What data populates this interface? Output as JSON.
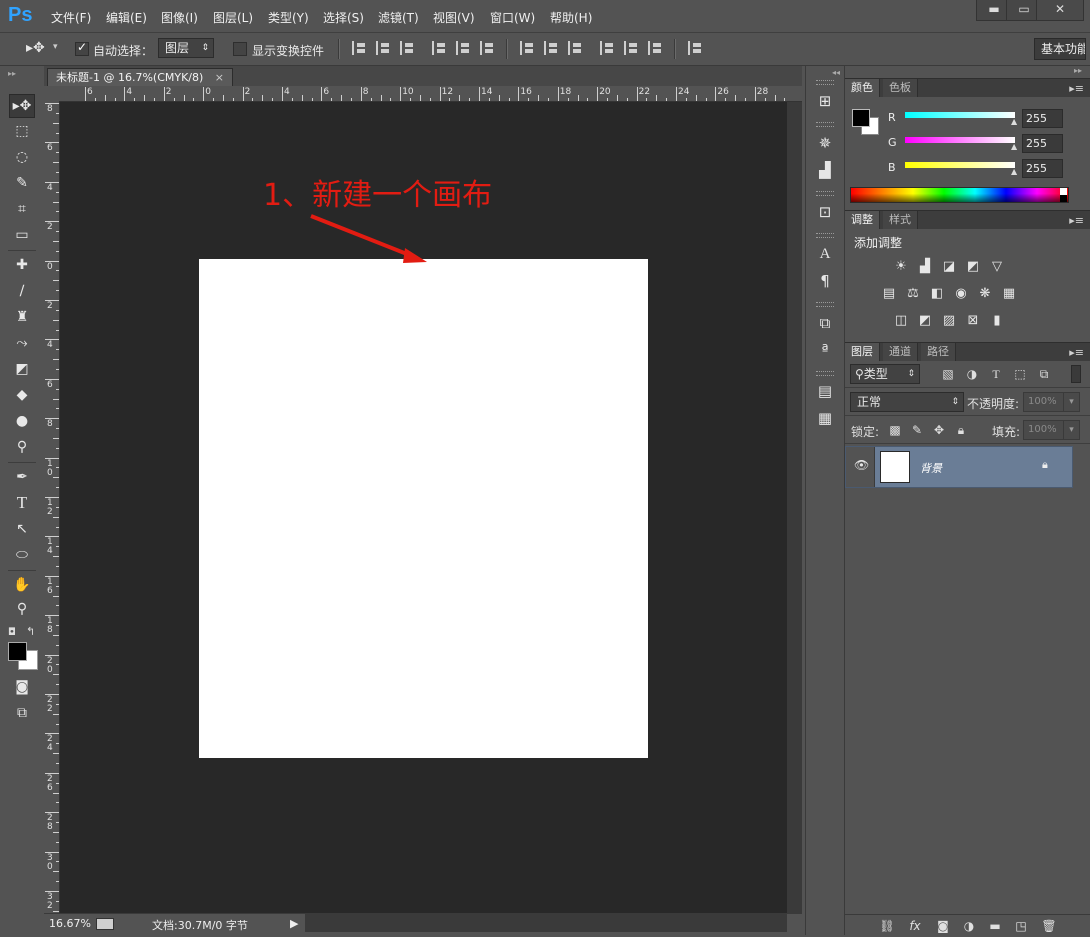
{
  "app": {
    "logo": "Ps"
  },
  "menu": {
    "items": [
      "文件(F)",
      "编辑(E)",
      "图像(I)",
      "图层(L)",
      "类型(Y)",
      "选择(S)",
      "滤镜(T)",
      "视图(V)",
      "窗口(W)",
      "帮助(H)"
    ]
  },
  "window_controls": {
    "minimize": "▬",
    "maximize": "▭",
    "close": "✕"
  },
  "options": {
    "auto_select_label": "自动选择：",
    "auto_select_checked": true,
    "target_value": "图层",
    "show_transform_label": "显示变换控件",
    "show_transform_checked": false,
    "workspace": "基本功能"
  },
  "document": {
    "tab_title": "未标题-1 @ 16.7%(CMYK/8)",
    "tab_close": "×",
    "h_ruler_labels": [
      "6",
      "4",
      "2",
      "0",
      "2",
      "4",
      "6",
      "8",
      "10",
      "12",
      "14",
      "16",
      "18",
      "20",
      "22",
      "24",
      "26",
      "28"
    ],
    "v_ruler_labels": [
      "8",
      "6",
      "4",
      "2",
      "0",
      "2",
      "4",
      "6",
      "8",
      "10",
      "12",
      "14",
      "16",
      "18",
      "20",
      "22",
      "24",
      "26",
      "28",
      "30",
      "32"
    ],
    "annotation": "1、新建一个画布"
  },
  "status": {
    "zoom": "16.67%",
    "doc_info": "文档:30.7M/0 字节",
    "arrow": "▶"
  },
  "color_panel": {
    "tabs": [
      "颜色",
      "色板"
    ],
    "channels": [
      {
        "label": "R",
        "value": "255",
        "color": "#00ffff"
      },
      {
        "label": "G",
        "value": "255",
        "color": "#ff00ff"
      },
      {
        "label": "B",
        "value": "255",
        "color": "#ffff00"
      }
    ]
  },
  "adjust_panel": {
    "tabs": [
      "调整",
      "样式"
    ],
    "title": "添加调整"
  },
  "layers_panel": {
    "tabs": [
      "图层",
      "通道",
      "路径"
    ],
    "filter_kind": "类型",
    "blend_mode": "正常",
    "opacity_label": "不透明度:",
    "opacity_value": "100%",
    "lock_label": "锁定:",
    "fill_label": "填充:",
    "fill_value": "100%",
    "layers": [
      {
        "name": "背景"
      }
    ]
  },
  "colors": {
    "accent_blue": "#30a3ff",
    "annotation_red": "#e21c12",
    "layer_selected": "#6a7d96"
  }
}
